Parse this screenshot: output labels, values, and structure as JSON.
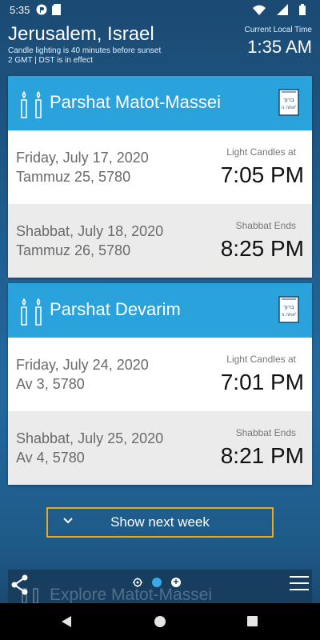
{
  "status_bar": {
    "time": "5:35"
  },
  "header": {
    "location": "Jerusalem, Israel",
    "subtitle_1": "Candle lighting is 40 minutes before sunset",
    "subtitle_2": "2 GMT | DST is in effect",
    "local_time_label": "Current Local Time",
    "local_time": "1:35 AM"
  },
  "weeks": [
    {
      "parsha": "Parshat Matot-Massei",
      "friday": {
        "date": "Friday, July 17, 2020",
        "hebrew": "Tammuz 25, 5780",
        "label": "Light Candles at",
        "time": "7:05 PM"
      },
      "shabbat": {
        "date": "Shabbat, July 18, 2020",
        "hebrew": "Tammuz 26, 5780",
        "label": "Shabbat Ends",
        "time": "8:25 PM"
      }
    },
    {
      "parsha": "Parshat Devarim",
      "friday": {
        "date": "Friday, July 24, 2020",
        "hebrew": "Av 3, 5780",
        "label": "Light Candles at",
        "time": "7:01 PM"
      },
      "shabbat": {
        "date": "Shabbat, July 25, 2020",
        "hebrew": "Av 4, 5780",
        "label": "Shabbat Ends",
        "time": "8:21 PM"
      }
    }
  ],
  "book_icon_text": "ברוך אתה ה'",
  "show_next_week_label": "Show next week",
  "bottom_panel": {
    "explore_label": "Explore Matot-Massei",
    "add_symbol": "+"
  },
  "colors": {
    "card_header": "#2aa3dd",
    "accent_border": "#e6a820",
    "active_dot": "#3aa9e8"
  }
}
